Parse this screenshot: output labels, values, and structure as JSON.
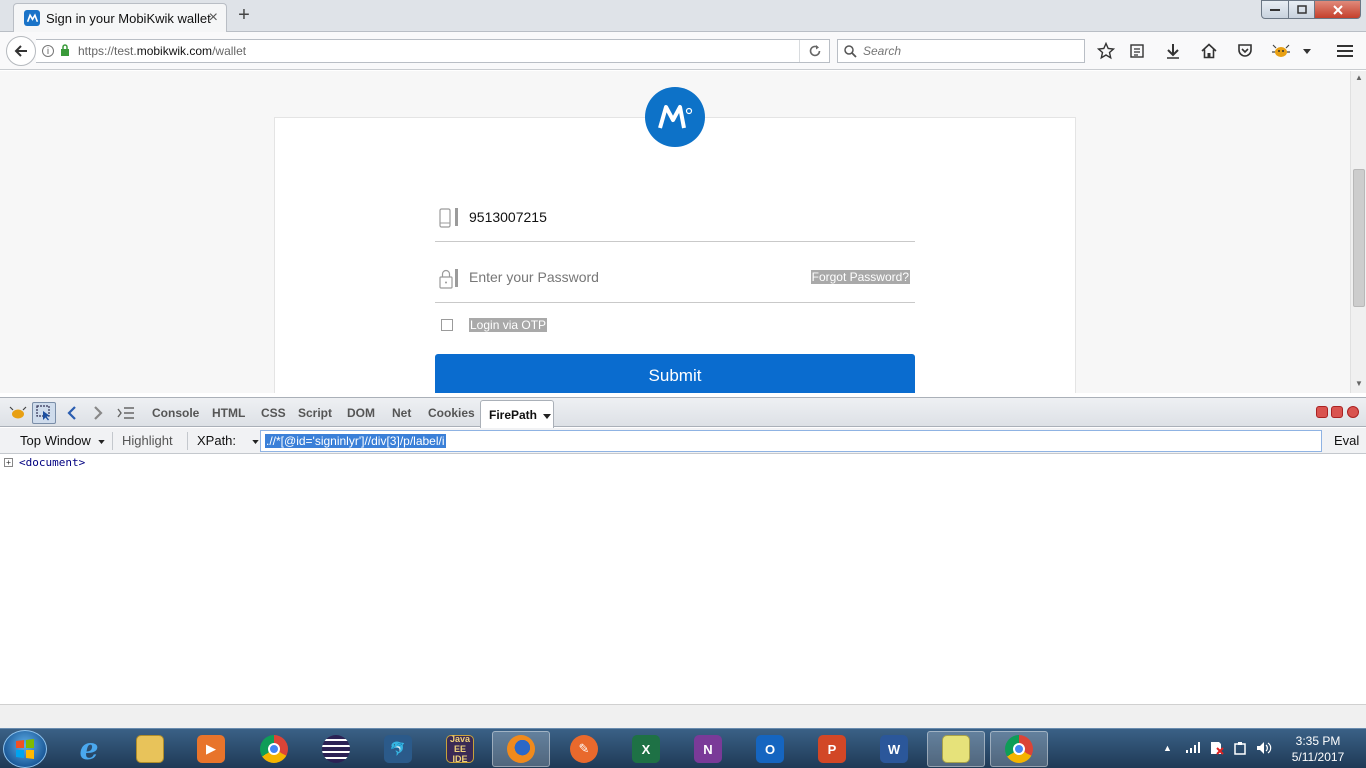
{
  "browser": {
    "tab_title": "Sign in your MobiKwik wallet",
    "new_tab_symbol": "+",
    "url_prefix": "https://test.",
    "url_domain": "mobikwik.com",
    "url_path": "/wallet",
    "search_placeholder": "Search"
  },
  "login_form": {
    "mobile_value": "9513007215",
    "password_placeholder": "Enter your Password",
    "forgot_password": "Forgot Password?",
    "otp_label": "Login via OTP",
    "submit_label": "Submit"
  },
  "firebug": {
    "tabs": [
      "Console",
      "HTML",
      "CSS",
      "Script",
      "DOM",
      "Net",
      "Cookies"
    ],
    "active_tab": "FirePath",
    "top_window": "Top Window",
    "highlight": "Highlight",
    "xpath_label": "XPath:",
    "xpath_value": ".//*[@id='signinlyr']//div[3]/p/label/i",
    "eval": "Eval",
    "document_node": "<document>"
  },
  "taskbar": {
    "time": "3:35 PM",
    "date": "5/11/2017",
    "apps": [
      "internet-explorer",
      "file-explorer",
      "media-player",
      "chrome",
      "eclipse",
      "mysql-workbench",
      "java-ee-ide",
      "firefox",
      "remote-tool",
      "excel",
      "onenote",
      "outlook",
      "powerpoint",
      "word",
      "sticky-notes",
      "chrome"
    ],
    "java_ee_label": "Java EE IDE"
  },
  "colors": {
    "brand_blue": "#0d72c8",
    "submit_blue": "#0a6ccf",
    "selection_blue": "#3b80d8"
  }
}
